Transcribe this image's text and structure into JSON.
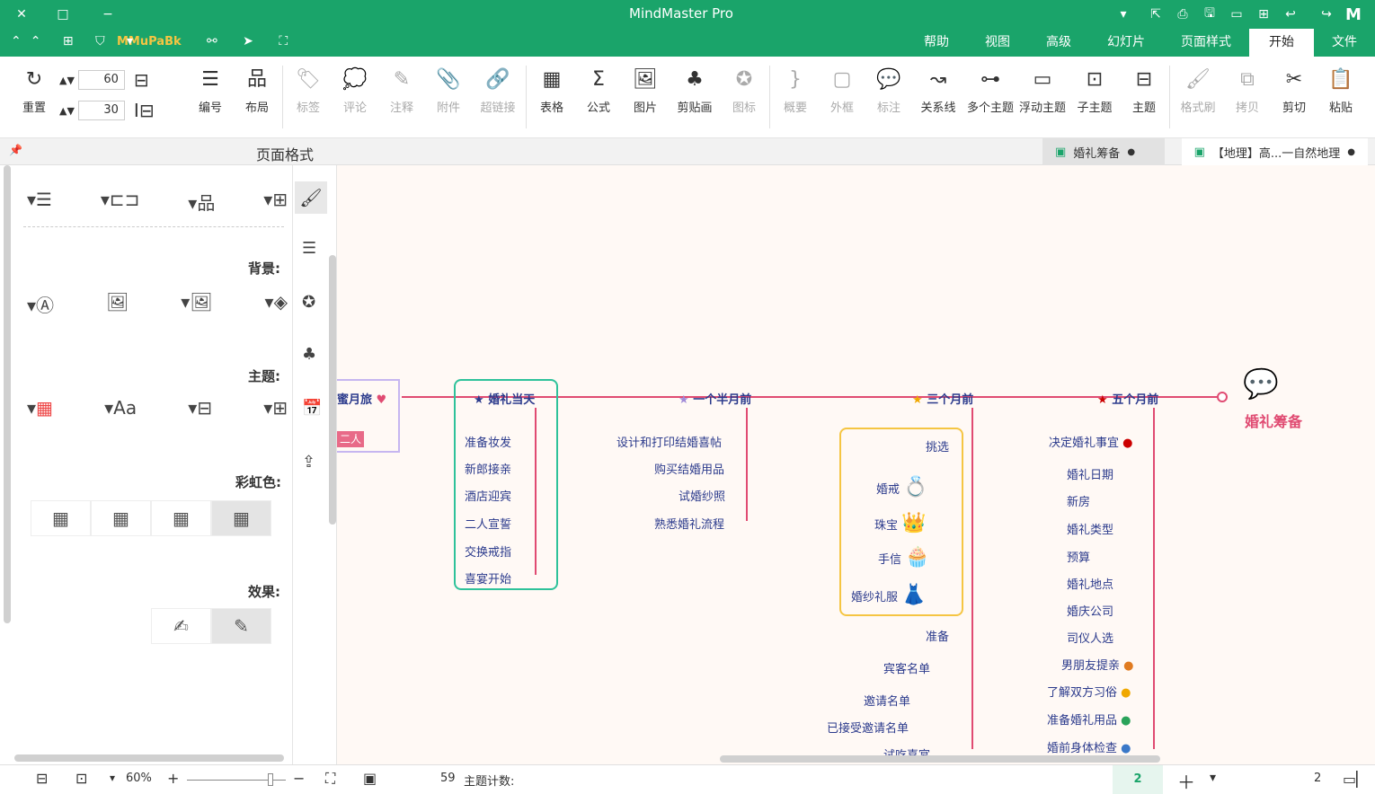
{
  "app": {
    "title": "MindMaster Pro",
    "user": "MMuPaBk",
    "colors": {
      "accent": "#1aa46a",
      "branch": "#e04b72",
      "text": "#2b3a8c"
    }
  },
  "titlebar": {
    "icons": [
      "logo-icon",
      "redo-icon",
      "undo-icon",
      "new-icon",
      "open-icon",
      "save-icon",
      "print-icon",
      "export-icon",
      "share-icon",
      "more-icon",
      "minimize-icon",
      "maximize-icon",
      "close-icon"
    ],
    "glyphs": {
      "logo": "M",
      "redo": "↪",
      "undo": "↩",
      "new": "⊞",
      "open": "▭",
      "save": "🖫",
      "print": "⎙",
      "export": "⇱",
      "share": "⤴",
      "more": "▾",
      "minimize": "−",
      "maximize": "□",
      "close": "✕"
    }
  },
  "menu": {
    "items": [
      "文件",
      "开始",
      "页面样式",
      "幻灯片",
      "高级",
      "视图",
      "帮助"
    ],
    "active": "开始"
  },
  "ribbon": {
    "groups": [
      {
        "name": "clipboard",
        "buttons": [
          {
            "label": "粘贴",
            "glyph": "📋"
          },
          {
            "label": "剪切",
            "glyph": "✂"
          },
          {
            "label": "拷贝",
            "glyph": "⧉",
            "disabled": true
          },
          {
            "label": "格式刷",
            "glyph": "🖌",
            "disabled": true
          }
        ]
      },
      {
        "name": "insert",
        "buttons": [
          {
            "label": "主题",
            "glyph": "⊟"
          },
          {
            "label": "子主题",
            "glyph": "⊡"
          },
          {
            "label": "浮动主题",
            "glyph": "▭"
          },
          {
            "label": "多个主题",
            "glyph": "⊶"
          },
          {
            "label": "关系线",
            "glyph": "↝"
          },
          {
            "label": "标注",
            "glyph": "💬",
            "disabled": true
          },
          {
            "label": "外框",
            "glyph": "▢",
            "disabled": true
          },
          {
            "label": "概要",
            "glyph": "}",
            "disabled": true
          }
        ]
      },
      {
        "name": "objects",
        "buttons": [
          {
            "label": "图标",
            "glyph": "✪",
            "disabled": true
          },
          {
            "label": "剪贴画",
            "glyph": "♣"
          },
          {
            "label": "图片",
            "glyph": "🖼"
          },
          {
            "label": "公式",
            "glyph": "Σ"
          },
          {
            "label": "表格",
            "glyph": "▦"
          }
        ]
      },
      {
        "name": "links",
        "buttons": [
          {
            "label": "超链接",
            "glyph": "🔗",
            "disabled": true
          },
          {
            "label": "附件",
            "glyph": "📎",
            "disabled": true
          },
          {
            "label": "注释",
            "glyph": "✎",
            "disabled": true
          },
          {
            "label": "评论",
            "glyph": "💭",
            "disabled": true
          },
          {
            "label": "标签",
            "glyph": "🏷",
            "disabled": true
          }
        ]
      },
      {
        "name": "layout",
        "buttons": [
          {
            "label": "布局",
            "glyph": "品"
          },
          {
            "label": "编号",
            "glyph": "☰"
          }
        ]
      }
    ],
    "spacing": {
      "h": "60",
      "v": "30",
      "reset": "重置"
    }
  },
  "doctabs": [
    {
      "label": "【地理】高...一自然地理",
      "active": false
    },
    {
      "label": "婚礼筹备",
      "active": true
    }
  ],
  "panel": {
    "title": "页面格式",
    "sections": {
      "background": "背景:",
      "theme": "主题:",
      "rainbow": "彩虹色:",
      "effect": "效果:"
    }
  },
  "mindmap": {
    "root": "婚礼筹备",
    "branches": [
      {
        "title": "五个月前",
        "children": [
          "决定婚礼事宜",
          "婚礼日期",
          "新房",
          "婚礼类型",
          "预算",
          "婚礼地点",
          "婚庆公司",
          "司仪人选",
          "男朋友提亲",
          "了解双方习俗",
          "准备婚礼用品",
          "婚前身体检查"
        ]
      },
      {
        "title": "三个月前",
        "children": [
          "挑选",
          "婚戒",
          "珠宝",
          "手信",
          "婚纱礼服",
          "准备",
          "宾客名单",
          "邀请名单",
          "已接受邀请名单",
          "试吃喜宴"
        ]
      },
      {
        "title": "一个半月前",
        "children": [
          "设计和打印结婚喜帖",
          "购买结婚用品",
          "试婚纱照",
          "熟悉婚礼流程"
        ]
      },
      {
        "title": "婚礼当天",
        "children": [
          "准备妆发",
          "新郎接亲",
          "酒店迎宾",
          "二人宣誓",
          "交换戒指",
          "喜宴开始"
        ]
      },
      {
        "title": "蜜月旅",
        "children": [
          "二人"
        ]
      }
    ]
  },
  "status": {
    "page": "2",
    "topic_count_label": "主题计数:",
    "topic_count": "59",
    "zoom": "60%"
  }
}
